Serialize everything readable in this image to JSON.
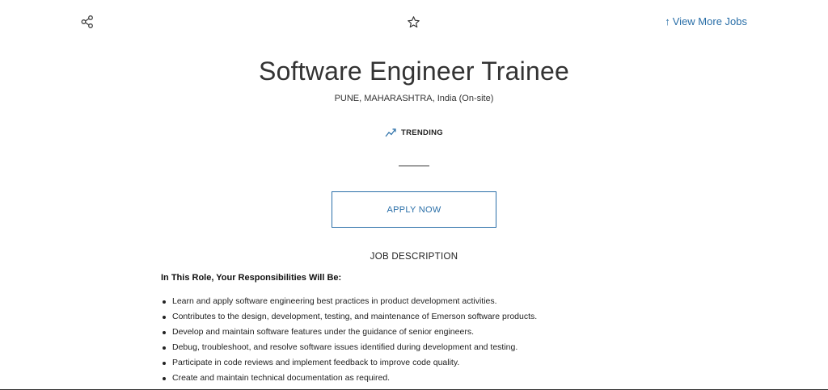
{
  "header": {
    "share_icon": "share-icon",
    "star_icon": "star-icon",
    "more_jobs_arrow": "↑",
    "more_jobs_label": "View More Jobs",
    "link_color": "#2a6fa8"
  },
  "job": {
    "title": "Software Engineer Trainee",
    "location": "PUNE, MAHARASHTRA, India (On-site)",
    "trending_label": "TRENDING",
    "trending_icon": "trending-up-icon",
    "apply_label": "APPLY NOW"
  },
  "description": {
    "heading": "JOB DESCRIPTION",
    "role_heading": "In This Role, Your Responsibilities Will Be:",
    "responsibilities": [
      "Learn and apply software engineering best practices in product development activities.",
      "Contributes to the design, development, testing, and maintenance of Emerson software products.",
      "Develop and maintain software features under the guidance of senior engineers.",
      "Debug, troubleshoot, and resolve software issues identified during development and testing.",
      "Participate in code reviews and implement feedback to improve code quality.",
      "Create and maintain technical documentation as required."
    ]
  }
}
